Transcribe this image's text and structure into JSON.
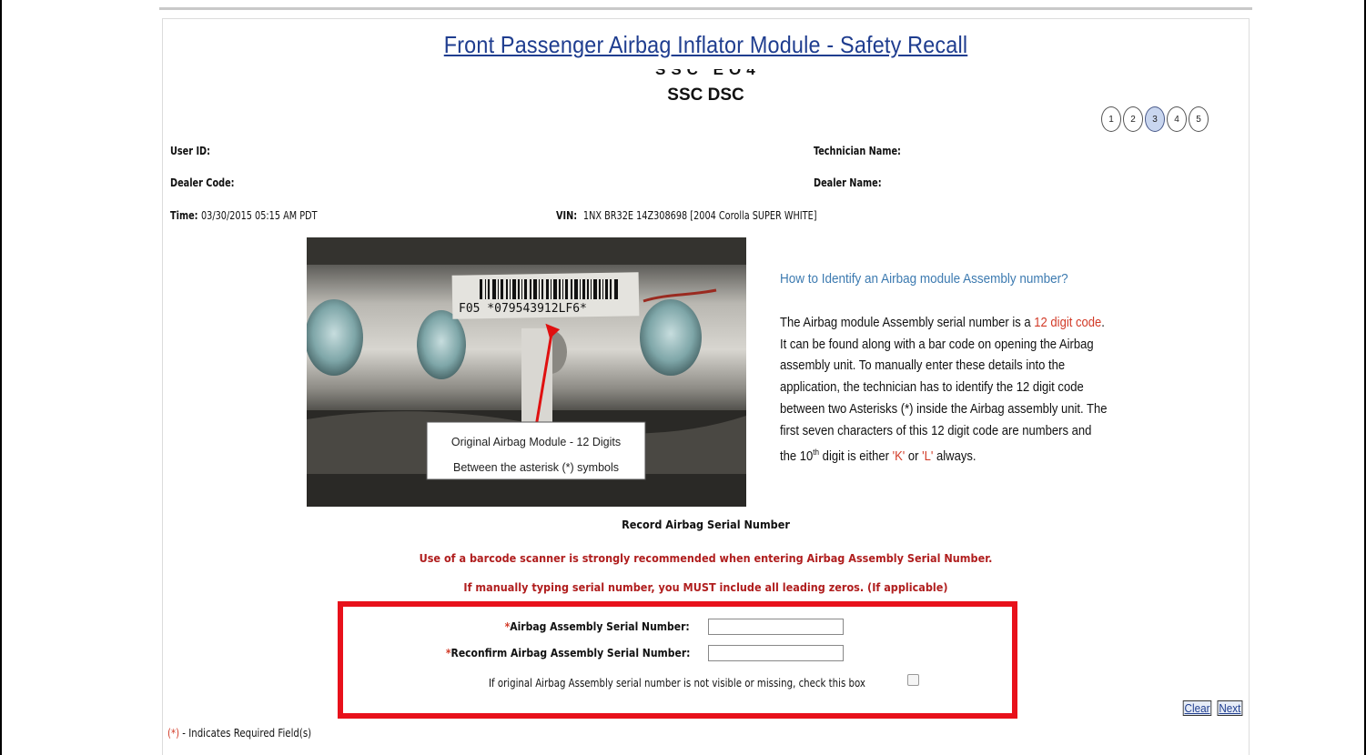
{
  "header": {
    "title": "Front Passenger Airbag Inflator Module - Safety Recall",
    "subtitle": "SSC DSC",
    "steps": [
      "1",
      "2",
      "3",
      "4",
      "5"
    ],
    "active_step": "3"
  },
  "user": {
    "user_id_label": "User ID:",
    "dealer_code_label": "Dealer Code:",
    "time_label": "Time:",
    "time_value": "03/30/2015 05:15 AM PDT",
    "technician_label": "Technician Name:",
    "dealer_name_label": "Dealer Name:",
    "vin_label": "VIN:",
    "vin_value": "1NX BR32E 14Z308698 [2004 Corolla SUPER WHITE]"
  },
  "photo": {
    "barcode_text": "F05 *079543912LF6*",
    "caption_line1": "Original Airbag Module - 12 Digits",
    "caption_line2": "Between the asterisk (*) symbols"
  },
  "info": {
    "title": "How to Identify an Airbag module Assembly number?",
    "body_part1": "The Airbag module Assembly serial number is a ",
    "body_red1": "12 digit code",
    "body_part2": ". It can be found along with a bar code on opening the Airbag assembly unit. To manually enter these details into the application, the technician has to identify the 12 digit code between two Asterisks (*) inside the Airbag assembly unit. The first seven characters of this 12 digit code are numbers and the 10",
    "body_sup": "th",
    "body_part3": " digit is either ",
    "body_red2": "'K'",
    "body_part4": " or ",
    "body_red3": "'L'",
    "body_part5": " always."
  },
  "record": {
    "title": "Record Airbag Serial Number",
    "warning1": "Use of a barcode scanner is strongly recommended when entering Airbag Assembly Serial Number.",
    "warning2": "If manually typing serial number, you MUST include all leading zeros. (If applicable)"
  },
  "form": {
    "required_mark": "*",
    "serial_label": "Airbag Assembly Serial Number:",
    "serial_value": "",
    "reconfirm_label": "Reconfirm Airbag Assembly Serial Number:",
    "reconfirm_value": "",
    "missing_label": "If original Airbag Assembly serial number is not visible or missing, check this box",
    "missing_checked": false
  },
  "buttons": {
    "clear": "Clear",
    "next": "Next"
  },
  "legend": {
    "req": "(*)",
    "text": " - Indicates Required Field(s)"
  },
  "colors": {
    "title_blue": "#1f3d8f",
    "info_blue": "#3c7ab0",
    "warning_red": "#b01e1e",
    "highlight_red": "#e8111b",
    "active_step": "#c9d6ef"
  }
}
